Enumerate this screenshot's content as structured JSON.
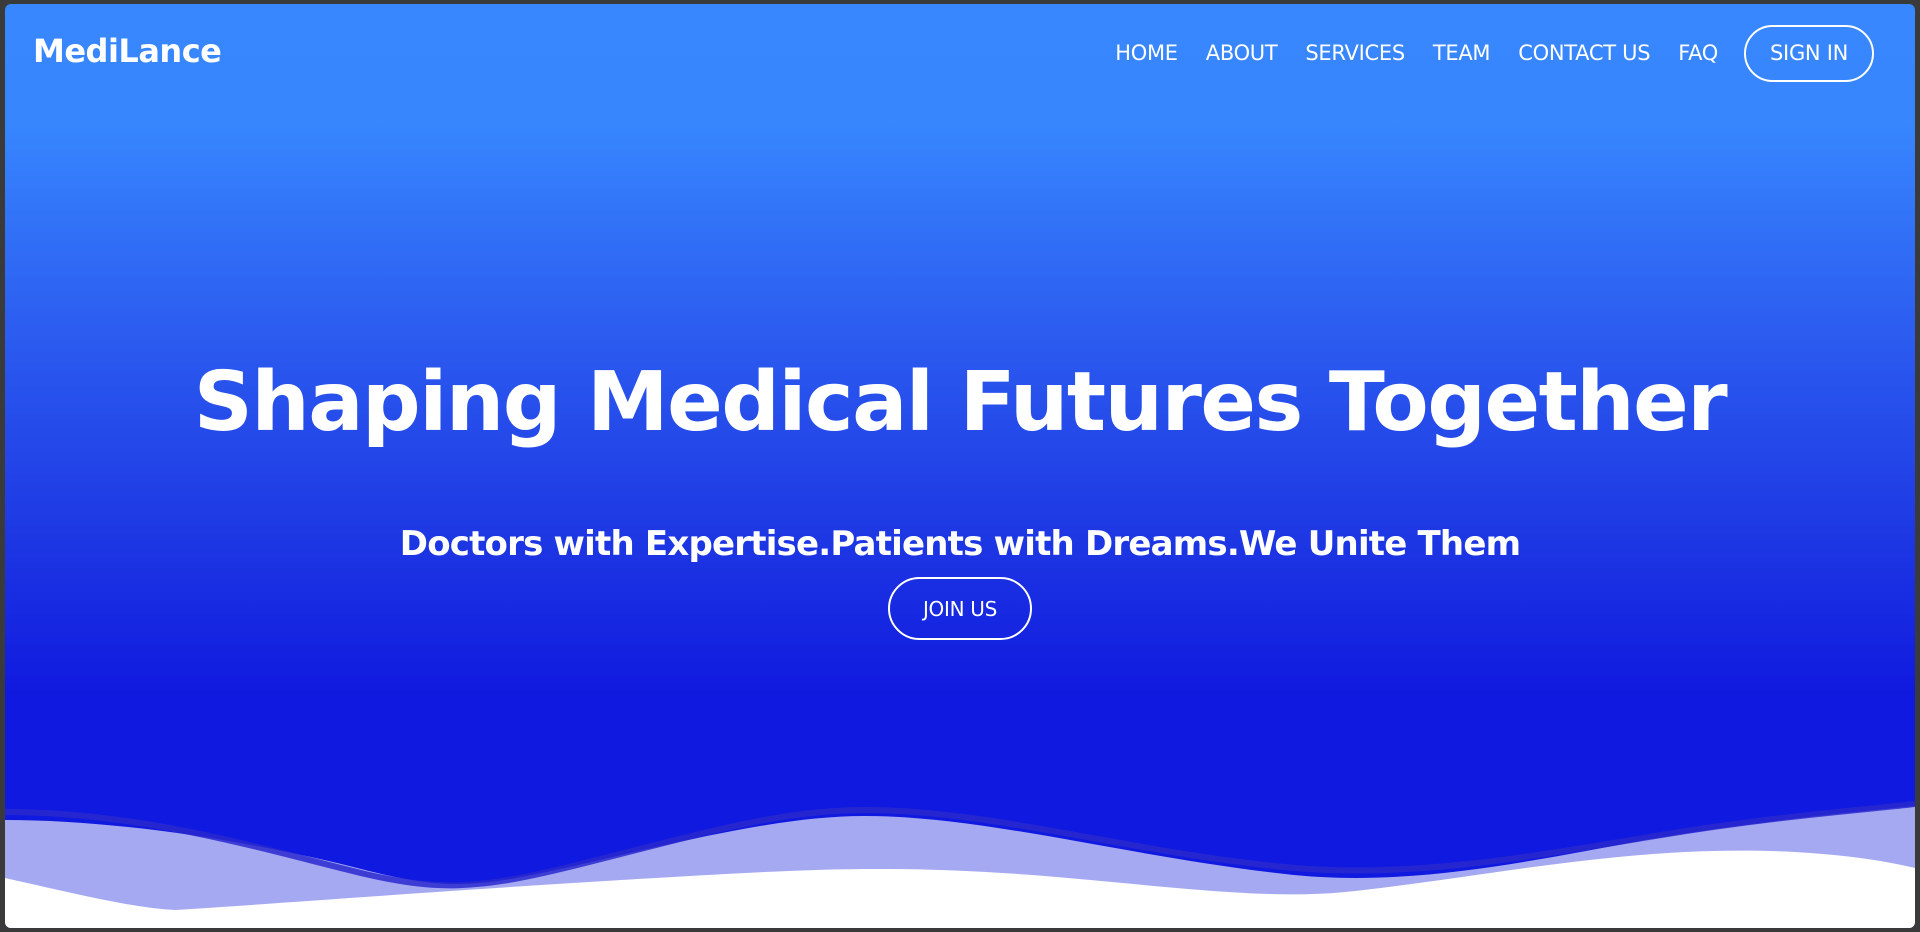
{
  "brand": {
    "name": "MediLance"
  },
  "nav": {
    "items": [
      {
        "label": "HOME"
      },
      {
        "label": "ABOUT"
      },
      {
        "label": "SERVICES"
      },
      {
        "label": "TEAM"
      },
      {
        "label": "CONTACT US"
      },
      {
        "label": "FAQ"
      }
    ],
    "signin_label": "SIGN IN"
  },
  "hero": {
    "title": "Shaping Medical Futures Together",
    "subtitle": "Doctors with Expertise.Patients with Dreams.We Unite Them",
    "cta_label": "JOIN US"
  },
  "colors": {
    "gradient_top": "#3887fe",
    "gradient_bottom": "#1019df",
    "wave_light": "#a5a9f2",
    "wave_dark": "#2a29cf",
    "text": "#ffffff"
  }
}
